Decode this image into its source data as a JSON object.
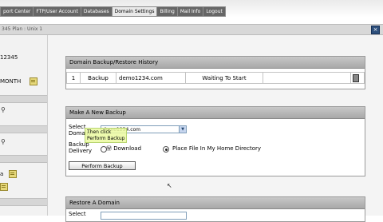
{
  "nav": {
    "items": [
      {
        "label": "port Center",
        "active": false
      },
      {
        "label": "FTP/User Account",
        "active": false
      },
      {
        "label": "Databases",
        "active": false
      },
      {
        "label": "Domain Settings",
        "active": true
      },
      {
        "label": "Billing",
        "active": false
      },
      {
        "label": "Mail Info",
        "active": false
      },
      {
        "label": "Logout",
        "active": false
      }
    ]
  },
  "titlebar": {
    "title": "345 Plan : Unix 1"
  },
  "sidebar": {
    "account_id": "12345",
    "period_label": "MONTH"
  },
  "history": {
    "heading": "Domain Backup/Restore History",
    "rows": [
      {
        "index": "1",
        "type": "Backup",
        "domain": "demo1234.com",
        "status": "Waiting To Start"
      }
    ]
  },
  "new_backup": {
    "heading": "Make A New Backup",
    "select_domain_label": "Select Domain",
    "domain_value": "demo1234.com",
    "delivery_label": "Backup Delivery",
    "option_download": "Download",
    "option_place": "Place File In My Home Directory",
    "perform_button": "Perform Backup",
    "tooltip_line1": "Then click",
    "tooltip_line2": "Perform Backup"
  },
  "restore": {
    "heading": "Restore A Domain",
    "select_label": "Select"
  }
}
